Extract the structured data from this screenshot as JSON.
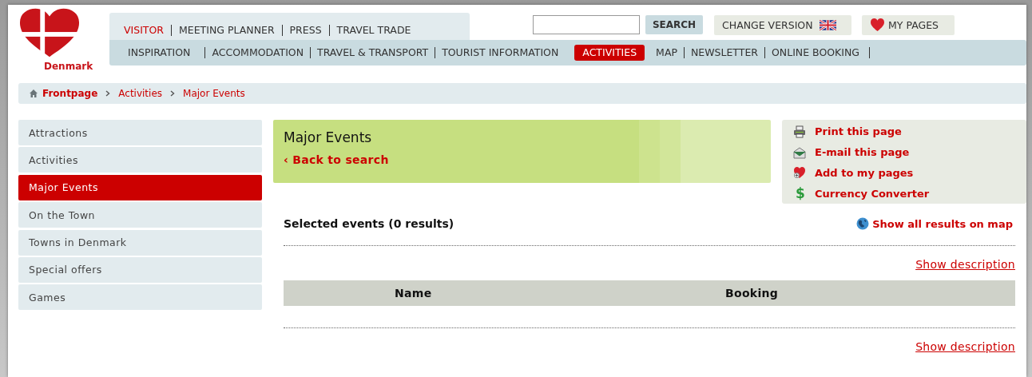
{
  "logo": {
    "text": "Denmark"
  },
  "audience_tabs": [
    {
      "label": "VISITOR",
      "selected": true
    },
    {
      "label": "MEETING PLANNER",
      "selected": false
    },
    {
      "label": "PRESS",
      "selected": false
    },
    {
      "label": "TRAVEL TRADE",
      "selected": false
    }
  ],
  "search": {
    "button": "SEARCH"
  },
  "change_version": {
    "label": "CHANGE VERSION"
  },
  "my_pages": {
    "label": "MY PAGES"
  },
  "main_nav": [
    {
      "label": "INSPIRATION",
      "selected": false
    },
    {
      "label": "ACCOMMODATION",
      "selected": false
    },
    {
      "label": "TRAVEL & TRANSPORT",
      "selected": false
    },
    {
      "label": "TOURIST INFORMATION",
      "selected": false
    },
    {
      "label": "ACTIVITIES",
      "selected": true
    },
    {
      "label": "MAP",
      "selected": false
    },
    {
      "label": "NEWSLETTER",
      "selected": false
    },
    {
      "label": "ONLINE BOOKING",
      "selected": false
    }
  ],
  "breadcrumb": [
    {
      "kind": "home",
      "label": "Frontpage"
    },
    {
      "kind": "link",
      "label": "Activities"
    },
    {
      "kind": "link",
      "label": "Major Events"
    }
  ],
  "sidebar": [
    {
      "label": "Attractions",
      "selected": false
    },
    {
      "label": "Activities",
      "selected": false
    },
    {
      "label": "Major Events",
      "selected": true
    },
    {
      "label": "On the Town",
      "selected": false
    },
    {
      "label": "Towns in Denmark",
      "selected": false
    },
    {
      "label": "Special offers",
      "selected": false
    },
    {
      "label": "Games",
      "selected": false
    }
  ],
  "header": {
    "title": "Major Events",
    "back_link": "‹ Back to search"
  },
  "actions": [
    {
      "kind": "print",
      "label": "Print this page"
    },
    {
      "kind": "email",
      "label": "E-mail this page"
    },
    {
      "kind": "favorite",
      "label": "Add to my pages"
    },
    {
      "kind": "currency",
      "icon": "$",
      "label": "Currency Converter"
    }
  ],
  "results": {
    "title": "Selected events (0 results)",
    "map_link": "Show all results on map",
    "show_description": [
      "Show description",
      "Show description"
    ],
    "columns": [
      "Name",
      "Booking"
    ]
  }
}
